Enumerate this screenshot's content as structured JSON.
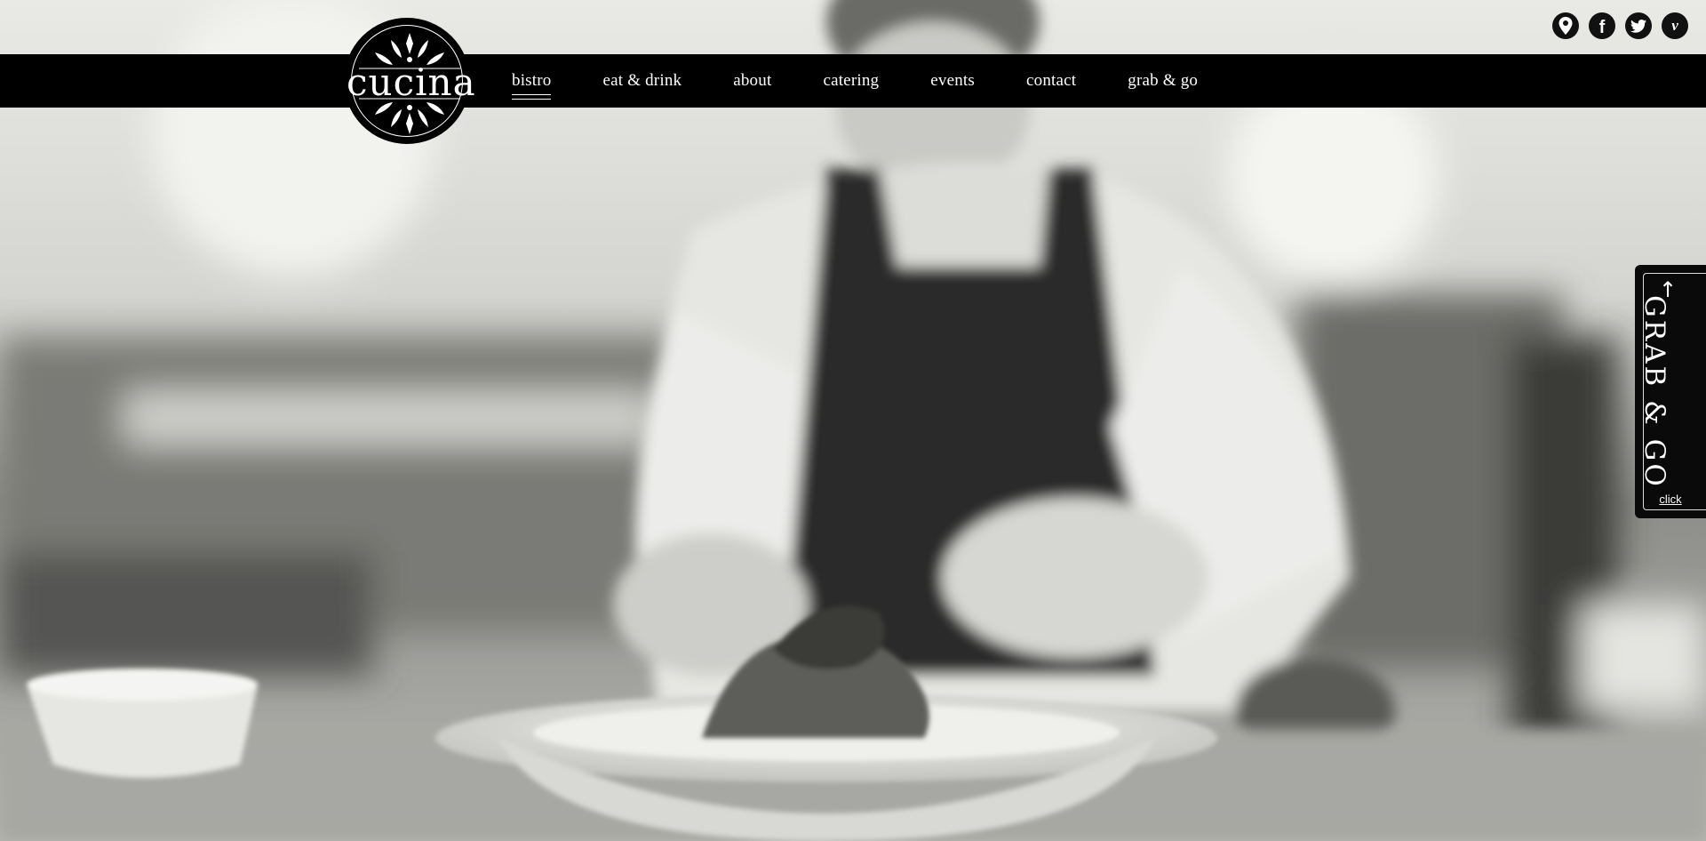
{
  "brand": {
    "logo_text": "cucina"
  },
  "nav": {
    "items": [
      {
        "label": "bistro",
        "active": true
      },
      {
        "label": "eat & drink"
      },
      {
        "label": "about"
      },
      {
        "label": "catering"
      },
      {
        "label": "events"
      },
      {
        "label": "contact"
      },
      {
        "label": "grab & go"
      }
    ]
  },
  "social": [
    "location-icon",
    "facebook-icon",
    "twitter-icon",
    "vimeo-icon"
  ],
  "side_tab": {
    "label": "GRAB & GO",
    "click_label": "click"
  },
  "hero": {
    "description": "black and white photo of chef plating a dish"
  },
  "colors": {
    "navbar": "#000000",
    "text": "#ffffff"
  }
}
